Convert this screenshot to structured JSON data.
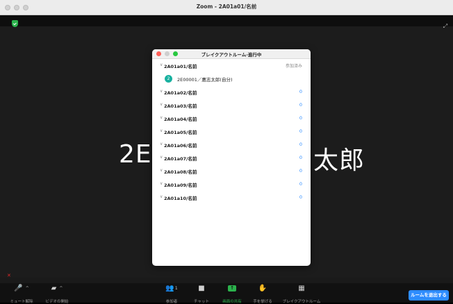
{
  "window": {
    "title": "Zoom - 2A01a01/名前"
  },
  "video": {
    "name_left": "2E",
    "name_right": "太郎"
  },
  "panel": {
    "title": "ブレイクアウトルーム-進行中",
    "rooms": [
      {
        "name": "2A01a01/名前",
        "status": "参加済み",
        "members": [
          {
            "initial": "2",
            "name": "2E00001／鷹志太郎(自分)"
          }
        ]
      },
      {
        "name": "2A01a02/名前",
        "status": "0"
      },
      {
        "name": "2A01a03/名前",
        "status": "0"
      },
      {
        "name": "2A01a04/名前",
        "status": "0"
      },
      {
        "name": "2A01a05/名前",
        "status": "0"
      },
      {
        "name": "2A01a06/名前",
        "status": "0"
      },
      {
        "name": "2A01a07/名前",
        "status": "0"
      },
      {
        "name": "2A01a08/名前",
        "status": "0"
      },
      {
        "name": "2A01a09/名前",
        "status": "0"
      },
      {
        "name": "2A01a10/名前",
        "status": "0"
      }
    ]
  },
  "toolbar": {
    "unmute": "ミュート解除",
    "start_video": "ビデオの開始",
    "participants": "参加者",
    "participants_count": "1",
    "chat": "チャット",
    "share": "画面の共有",
    "raise_hand": "手を挙げる",
    "breakout": "ブレイクアウトルーム",
    "leave_room": "ルームを退出する"
  },
  "colors": {
    "accent": "#2d8cff",
    "share_green": "#2bb24c",
    "member_badge": "#19b1a0",
    "muted_red": "#e02828"
  },
  "icons": [
    "shield-icon",
    "expand-icon",
    "mic-muted-icon",
    "video-off-icon",
    "participants-icon",
    "chat-icon",
    "share-screen-icon",
    "hand-icon",
    "breakout-grid-icon",
    "chevron-down-icon"
  ]
}
